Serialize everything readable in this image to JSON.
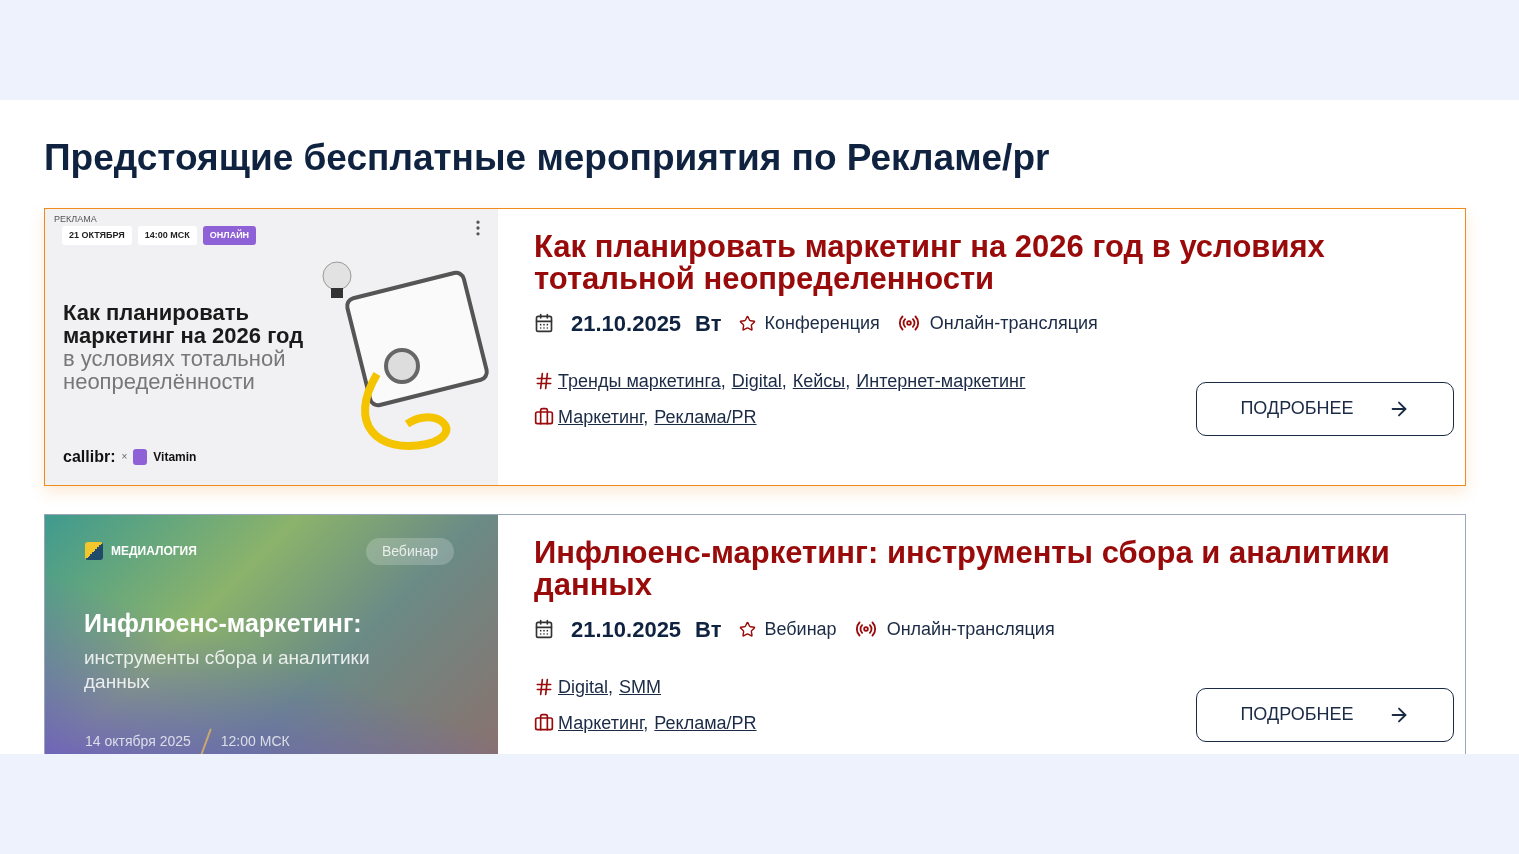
{
  "heading": "Предстоящие бесплатные мероприятия по Рекламе/pr",
  "events": [
    {
      "highlighted": true,
      "banner": {
        "kind": "light",
        "ad_label": "РЕКЛАМА",
        "chips": [
          {
            "text": "21 ОКТЯБРЯ",
            "accent": false
          },
          {
            "text": "14:00 МСК",
            "accent": false
          },
          {
            "text": "ОНЛАЙН",
            "accent": true
          }
        ],
        "title": "Как планировать маркетинг на 2026 год",
        "subtitle": "в условиях тотальной неопределённости",
        "logos": [
          "callibr:",
          "×",
          "Vitamin"
        ]
      },
      "title": "Как планировать маркетинг на 2026 год в условиях тотальной неопределенности",
      "date": "21.10.2025",
      "weekday": "Вт",
      "format": "Конференция",
      "mode": "Онлайн-трансляция",
      "separator": ",",
      "tags": [
        "Тренды маркетинга",
        "Digital",
        "Кейсы",
        "Интернет-маркетинг"
      ],
      "categories": [
        "Маркетинг",
        "Реклама/PR"
      ],
      "button": "ПОДРОБНЕЕ"
    },
    {
      "highlighted": false,
      "banner": {
        "kind": "gradient",
        "brand": "МЕДИАЛОГИЯ",
        "badge": "Вебинар",
        "title": "Инфлюенс-маркетинг:",
        "subtitle": "инструменты сбора и аналитики данных",
        "date": "14 октября 2025",
        "time": "12:00 МСК"
      },
      "title": "Инфлюенс-маркетинг: инструменты сбора и аналитики данных",
      "date": "21.10.2025",
      "weekday": "Вт",
      "format": "Вебинар",
      "mode": "Онлайн-трансляция",
      "separator": ",",
      "tags": [
        "Digital",
        "SMM"
      ],
      "categories": [
        "Маркетинг",
        "Реклама/PR"
      ],
      "button": "ПОДРОБНЕЕ"
    }
  ]
}
